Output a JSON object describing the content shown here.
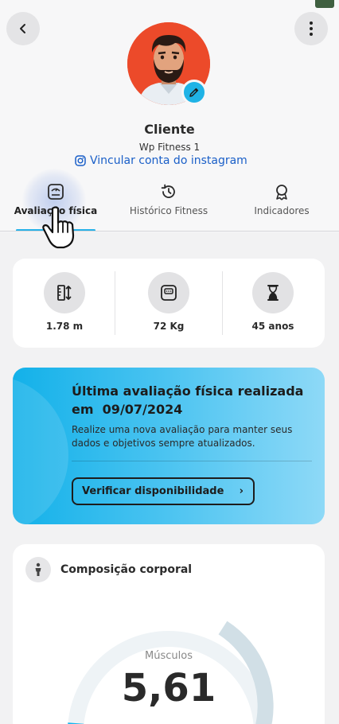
{
  "profile": {
    "name": "Cliente",
    "gym": "Wp Fitness 1",
    "instagram_link": "Vincular conta do instagram"
  },
  "tabs": [
    {
      "label": "Avaliação física",
      "icon": "scale-icon",
      "active": true
    },
    {
      "label": "Histórico Fitness",
      "icon": "history-icon",
      "active": false
    },
    {
      "label": "Indicadores",
      "icon": "award-icon",
      "active": false
    }
  ],
  "stats": [
    {
      "value": "1.78 m",
      "icon": "height-icon"
    },
    {
      "value": "72 Kg",
      "icon": "scale-icon"
    },
    {
      "value": "45 anos",
      "icon": "hourglass-icon"
    }
  ],
  "evaluation": {
    "title": "Última avaliação física realizada em",
    "date": "09/07/2024",
    "description": "Realize uma nova avaliação para manter seus dados e objetivos sempre atualizados.",
    "button_label": "Verificar disponibilidade",
    "button_chevron": "›"
  },
  "composition": {
    "title": "Composição corporal",
    "gauge_label": "Músculos",
    "gauge_value": "5,61"
  },
  "colors": {
    "accent": "#27b2e8",
    "avatar_bg": "#ec4a2a",
    "link": "#1a5fc8"
  }
}
